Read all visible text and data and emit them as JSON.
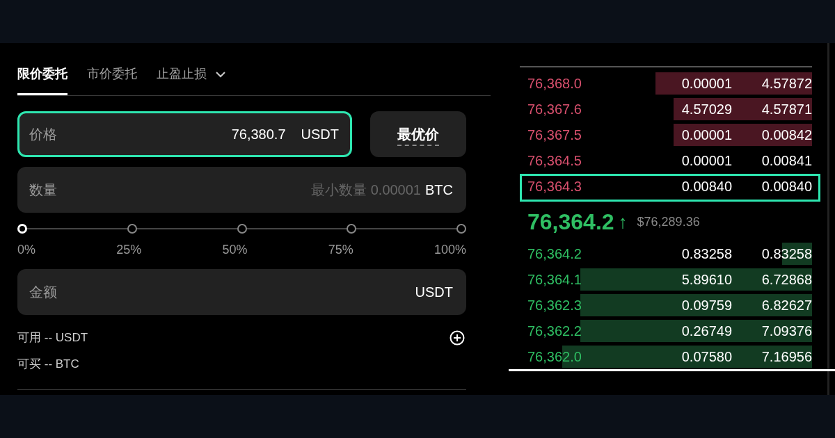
{
  "order_form": {
    "tabs": [
      {
        "label": "限价委托",
        "selected": true,
        "kind": "plain"
      },
      {
        "label": "市价委托",
        "selected": false,
        "kind": "plain"
      },
      {
        "label": "止盈止损",
        "selected": false,
        "kind": "dropdown"
      }
    ],
    "price_field": {
      "label": "价格",
      "value": "76,380.7",
      "unit": "USDT",
      "focused": true
    },
    "best_price_button": "最优价",
    "amount_field": {
      "label": "数量",
      "placeholder": "最小数量 0.00001",
      "unit": "BTC",
      "focused": false
    },
    "slider": {
      "level": 0,
      "marks": [
        "0%",
        "25%",
        "50%",
        "75%",
        "100%"
      ]
    },
    "total_field": {
      "label": "金额",
      "unit": "USDT",
      "focused": false
    },
    "available": "可用 -- USDT",
    "can_buy": "可买 -- BTC"
  },
  "order_book": {
    "asks": [
      {
        "price": "76,368.0",
        "amount": "0.00001",
        "total": "4.57872",
        "level": 0.52,
        "highlighted": false
      },
      {
        "price": "76,367.6",
        "amount": "4.57029",
        "total": "4.57871",
        "level": 0.46,
        "highlighted": false
      },
      {
        "price": "76,367.5",
        "amount": "0.00001",
        "total": "0.00842",
        "level": 0.46,
        "highlighted": false
      },
      {
        "price": "76,364.5",
        "amount": "0.00001",
        "total": "0.00841",
        "highlighted": false
      },
      {
        "price": "76,364.3",
        "amount": "0.00840",
        "total": "0.00840",
        "highlighted": true
      }
    ],
    "last_price": {
      "value": "76,364.2",
      "arrow": "↑",
      "usd": "$76,289.36"
    },
    "bids": [
      {
        "price": "76,364.2",
        "amount": "0.83258",
        "total": "0.83258",
        "level": 0.1,
        "highlighted": false
      },
      {
        "price": "76,364.1",
        "amount": "5.89610",
        "total": "6.72868",
        "level": 0.77,
        "highlighted": false
      },
      {
        "price": "76,362.3",
        "amount": "0.09759",
        "total": "6.82627",
        "level": 0.77,
        "highlighted": false
      },
      {
        "price": "76,362.2",
        "amount": "0.26749",
        "total": "7.09376",
        "level": 0.77,
        "highlighted": false
      },
      {
        "price": "76,362.0",
        "amount": "0.07580",
        "total": "7.16956",
        "level": 0.83,
        "highlighted": false
      }
    ]
  }
}
